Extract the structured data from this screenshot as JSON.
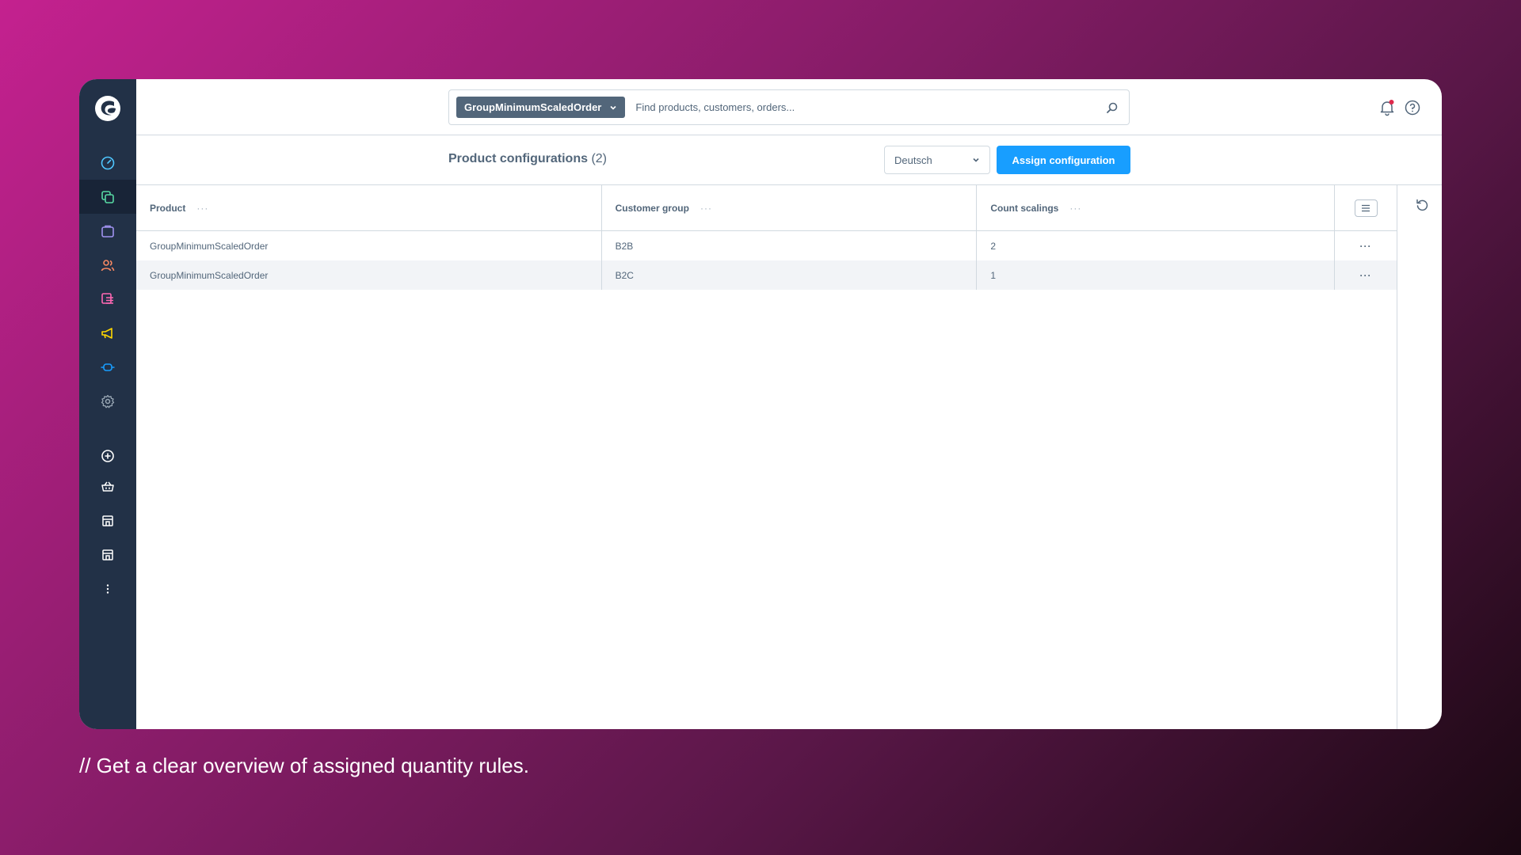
{
  "header": {
    "search_type": "GroupMinimumScaledOrder",
    "search_placeholder": "Find products, customers, orders..."
  },
  "sidebar": {
    "items": [
      {
        "icon": "dashboard-icon",
        "color": "#4fc7ff"
      },
      {
        "icon": "catalogue-icon",
        "color": "#57d9a3",
        "active": true
      },
      {
        "icon": "orders-icon",
        "color": "#a092f0"
      },
      {
        "icon": "customers-icon",
        "color": "#f88962"
      },
      {
        "icon": "content-icon",
        "color": "#ff68b4"
      },
      {
        "icon": "marketing-icon",
        "color": "#ffd700"
      },
      {
        "icon": "extensions-icon",
        "color": "#189eff"
      },
      {
        "icon": "settings-icon",
        "color": "#9aa8b5"
      },
      {
        "icon": "add-sales-channel-icon",
        "color": "#ffffff"
      },
      {
        "icon": "headless-basket-icon",
        "color": "#ffffff"
      },
      {
        "icon": "storefront-icon",
        "color": "#ffffff"
      },
      {
        "icon": "storefront-2-icon",
        "color": "#ffffff"
      },
      {
        "icon": "more-icon",
        "color": "#ffffff"
      }
    ]
  },
  "page": {
    "title": "Product configurations",
    "count": "(2)",
    "language": "Deutsch",
    "assign_label": "Assign configuration"
  },
  "grid": {
    "columns": [
      "Product",
      "Customer group",
      "Count scalings"
    ],
    "rows": [
      {
        "product": "GroupMinimumScaledOrder",
        "group": "B2B",
        "count": "2"
      },
      {
        "product": "GroupMinimumScaledOrder",
        "group": "B2C",
        "count": "1"
      }
    ]
  },
  "caption": "//  Get a clear overview of assigned quantity rules."
}
